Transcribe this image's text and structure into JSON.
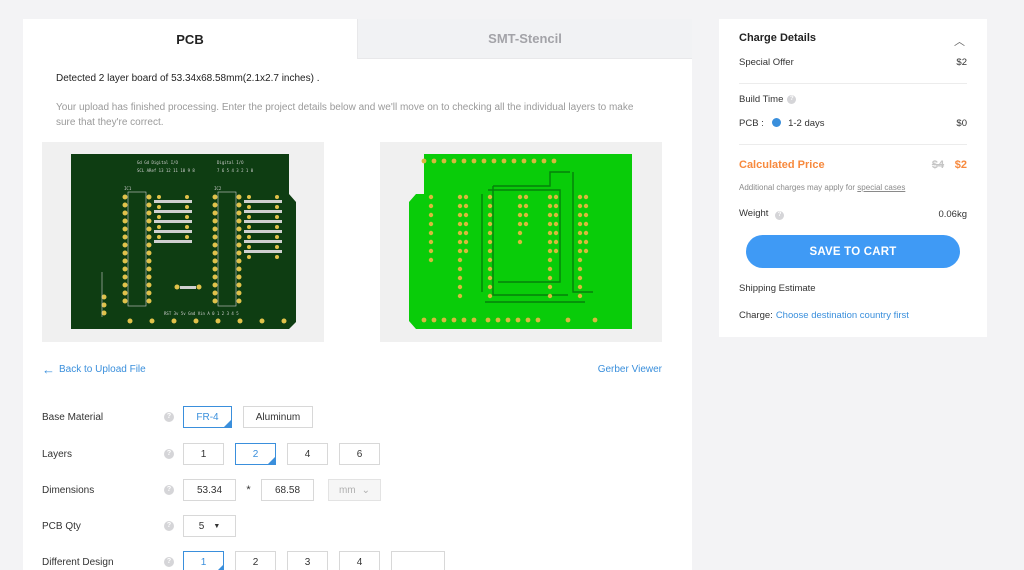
{
  "tabs": [
    {
      "label": "PCB"
    },
    {
      "label": "SMT-Stencil"
    }
  ],
  "detected_text": "Detected 2 layer board of 53.34x68.58mm(2.1x2.7 inches) .",
  "notice_text": "Your upload has finished processing. Enter the project details below and we'll move on to checking all the individual layers to make sure that they're correct.",
  "back_link": "Back to Upload File",
  "gerber_link": "Gerber Viewer",
  "form": {
    "base_material": {
      "label": "Base Material",
      "options": [
        "FR-4",
        "Aluminum"
      ],
      "selected": "FR-4"
    },
    "layers": {
      "label": "Layers",
      "options": [
        "1",
        "2",
        "4",
        "6"
      ],
      "selected": "2"
    },
    "dimensions": {
      "label": "Dimensions",
      "width": "53.34",
      "separator": "*",
      "height": "68.58",
      "unit": "mm"
    },
    "pcb_qty": {
      "label": "PCB Qty",
      "value": "5"
    },
    "different_design": {
      "label": "Different Design",
      "options": [
        "1",
        "2",
        "3",
        "4",
        ""
      ],
      "selected": "1"
    }
  },
  "help_icon": "?",
  "sidebar": {
    "title": "Charge Details",
    "special_offer": {
      "label": "Special Offer",
      "value": "$2"
    },
    "build_time": {
      "label": "Build Time"
    },
    "pcb_build": {
      "label": "PCB :",
      "option": "1-2 days",
      "value": "$0"
    },
    "calculated_price": {
      "label": "Calculated Price",
      "old": "$4",
      "new": "$2"
    },
    "note": "Additional charges may apply for ",
    "note_link": "special cases",
    "weight": {
      "label": "Weight",
      "value": "0.06kg"
    },
    "save_button": "SAVE TO CART",
    "shipping": "Shipping Estimate",
    "charge": {
      "label": "Charge:",
      "link": "Choose destination country first"
    }
  },
  "colors": {
    "accent": "#3a8fdc",
    "price": "#f7893d",
    "button": "#3f9af5",
    "pcb_dark": "#0e3d12",
    "pcb_green": "#09cc09"
  }
}
